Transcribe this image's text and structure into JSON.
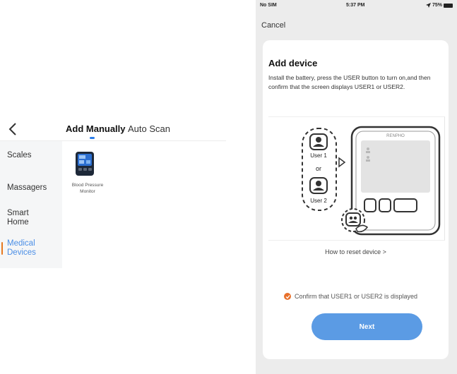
{
  "left_screen": {
    "tabs": [
      {
        "label": "Add Manually",
        "active": true
      },
      {
        "label": "Auto Scan",
        "active": false
      }
    ],
    "categories": [
      {
        "label": "Scales",
        "active": false
      },
      {
        "label": "Massagers",
        "active": false
      },
      {
        "label": "Smart Home",
        "active": false
      },
      {
        "label": "Medical Devices",
        "active": true
      }
    ],
    "devices": [
      {
        "label": "Blood Pressure Monitor",
        "icon": "blood-pressure-monitor-icon"
      }
    ],
    "accent_color": "#2b7de9",
    "active_category_color": "#4a8ee6",
    "active_category_bar_color": "#e6781f"
  },
  "right_screen": {
    "status_bar": {
      "carrier": "No SIM",
      "time": "5:37 PM",
      "battery": "75%"
    },
    "cancel_label": "Cancel",
    "card": {
      "title": "Add device",
      "description": "Install the battery, press the USER button to turn on,and then confirm that the screen displays USER1 or USER2.",
      "illustration": {
        "user1_label": "User 1",
        "or_label": "or",
        "user2_label": "User 2",
        "device_brand": "RENPHO"
      },
      "reset_link": "How to reset device >",
      "confirm_text": "Confirm that USER1 or USER2 is displayed",
      "confirm_checked": true,
      "next_label": "Next"
    },
    "button_color": "#5b9be4",
    "check_color": "#e8702a"
  }
}
